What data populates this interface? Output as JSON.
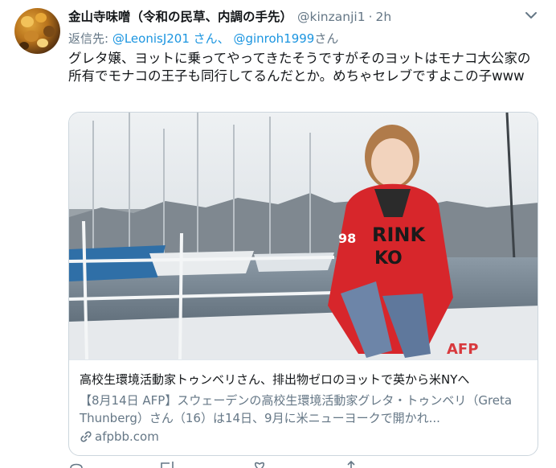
{
  "tweet": {
    "display_name": "金山寺味噌（令和の民草、内調の手先）",
    "handle": "@kinzanji1",
    "separator": "·",
    "time": "2h",
    "reply_prefix": "返信先:",
    "reply_mention_1": "@LeonisJ201 さん、",
    "reply_mention_2": "@ginroh1999",
    "reply_suffix": "さん",
    "text": "グレタ嬢、ヨットに乗ってやってきたそうですがそのヨットはモナコ大公家の所有でモナコの王子も同行してるんだとか。めちゃセレブですよこの子www"
  },
  "card": {
    "image_alt": "Greta Thunberg on a yacht deck in harbor",
    "image_watermark": "AFP",
    "hoodie_print": "RINK KO 98",
    "title": "高校生環境活動家トゥンベリさん、排出物ゼロのヨットで英から米NYへ",
    "description": "【8月14日 AFP】スウェーデンの高校生環境活動家グレタ・トゥンベリ（Greta Thunberg）さん（16）は14日、9月に米ニューヨークで開かれ...",
    "domain": "afpbb.com"
  },
  "icons": {
    "caret": "chevron-down-icon",
    "link": "link-icon",
    "reply": "reply-icon",
    "retweet": "retweet-icon",
    "like": "heart-icon",
    "share": "share-icon"
  },
  "colors": {
    "link_blue": "#1b95e0",
    "muted": "#657786",
    "text": "#14171a",
    "border": "#ccd6dd",
    "hoodie_red": "#d7262b"
  }
}
